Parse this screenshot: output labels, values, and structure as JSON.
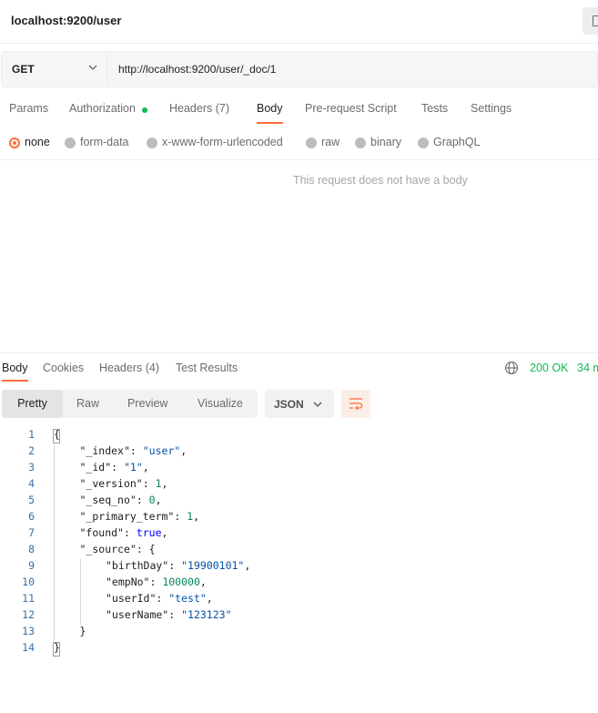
{
  "title": "localhost:9200/user",
  "request": {
    "method": "GET",
    "url": "http://localhost:9200/user/_doc/1"
  },
  "request_tabs": [
    {
      "label": "Params"
    },
    {
      "label": "Authorization"
    },
    {
      "label": "Headers",
      "count": "(7)"
    },
    {
      "label": "Body"
    },
    {
      "label": "Pre-request Script"
    },
    {
      "label": "Tests"
    },
    {
      "label": "Settings"
    }
  ],
  "body_types": [
    {
      "label": "none",
      "selected": true
    },
    {
      "label": "form-data"
    },
    {
      "label": "x-www-form-urlencoded"
    },
    {
      "label": "raw"
    },
    {
      "label": "binary"
    },
    {
      "label": "GraphQL"
    }
  ],
  "empty_body_message": "This request does not have a body",
  "response_tabs": [
    {
      "label": "Body"
    },
    {
      "label": "Cookies"
    },
    {
      "label": "Headers",
      "count": "(4)"
    },
    {
      "label": "Test Results"
    }
  ],
  "response_status": "200 OK",
  "response_time": "34 m",
  "view_modes": [
    "Pretty",
    "Raw",
    "Preview",
    "Visualize"
  ],
  "format": "JSON",
  "colors": {
    "accent": "#ff6c37",
    "success": "#0cbb52",
    "string": "#0451a5",
    "number": "#098658",
    "keyword": "#0000ff",
    "line_number": "#3a6ea5"
  },
  "icons": [
    "save-icon",
    "chevron-down-icon",
    "globe-icon",
    "wrap-lines-icon"
  ],
  "code_lines": [
    {
      "n": "1",
      "indent": 0,
      "parts": [
        [
          "punc",
          "{"
        ]
      ]
    },
    {
      "n": "2",
      "indent": 1,
      "parts": [
        [
          "key",
          "\"_index\""
        ],
        [
          "punc",
          ": "
        ],
        [
          "str",
          "\"user\""
        ],
        [
          "punc",
          ","
        ]
      ]
    },
    {
      "n": "3",
      "indent": 1,
      "parts": [
        [
          "key",
          "\"_id\""
        ],
        [
          "punc",
          ": "
        ],
        [
          "str",
          "\"1\""
        ],
        [
          "punc",
          ","
        ]
      ]
    },
    {
      "n": "4",
      "indent": 1,
      "parts": [
        [
          "key",
          "\"_version\""
        ],
        [
          "punc",
          ": "
        ],
        [
          "num",
          "1"
        ],
        [
          "punc",
          ","
        ]
      ]
    },
    {
      "n": "5",
      "indent": 1,
      "parts": [
        [
          "key",
          "\"_seq_no\""
        ],
        [
          "punc",
          ": "
        ],
        [
          "num",
          "0"
        ],
        [
          "punc",
          ","
        ]
      ]
    },
    {
      "n": "6",
      "indent": 1,
      "parts": [
        [
          "key",
          "\"_primary_term\""
        ],
        [
          "punc",
          ": "
        ],
        [
          "num",
          "1"
        ],
        [
          "punc",
          ","
        ]
      ]
    },
    {
      "n": "7",
      "indent": 1,
      "parts": [
        [
          "key",
          "\"found\""
        ],
        [
          "punc",
          ": "
        ],
        [
          "kw",
          "true"
        ],
        [
          "punc",
          ","
        ]
      ]
    },
    {
      "n": "8",
      "indent": 1,
      "parts": [
        [
          "key",
          "\"_source\""
        ],
        [
          "punc",
          ": {"
        ]
      ]
    },
    {
      "n": "9",
      "indent": 2,
      "parts": [
        [
          "key",
          "\"birthDay\""
        ],
        [
          "punc",
          ": "
        ],
        [
          "str",
          "\"19900101\""
        ],
        [
          "punc",
          ","
        ]
      ]
    },
    {
      "n": "10",
      "indent": 2,
      "parts": [
        [
          "key",
          "\"empNo\""
        ],
        [
          "punc",
          ": "
        ],
        [
          "num",
          "100000"
        ],
        [
          "punc",
          ","
        ]
      ]
    },
    {
      "n": "11",
      "indent": 2,
      "parts": [
        [
          "key",
          "\"userId\""
        ],
        [
          "punc",
          ": "
        ],
        [
          "str",
          "\"test\""
        ],
        [
          "punc",
          ","
        ]
      ]
    },
    {
      "n": "12",
      "indent": 2,
      "parts": [
        [
          "key",
          "\"userName\""
        ],
        [
          "punc",
          ": "
        ],
        [
          "str",
          "\"123123\""
        ]
      ]
    },
    {
      "n": "13",
      "indent": 1,
      "parts": [
        [
          "punc",
          "}"
        ]
      ]
    },
    {
      "n": "14",
      "indent": 0,
      "parts": [
        [
          "punc",
          "}"
        ]
      ]
    }
  ]
}
